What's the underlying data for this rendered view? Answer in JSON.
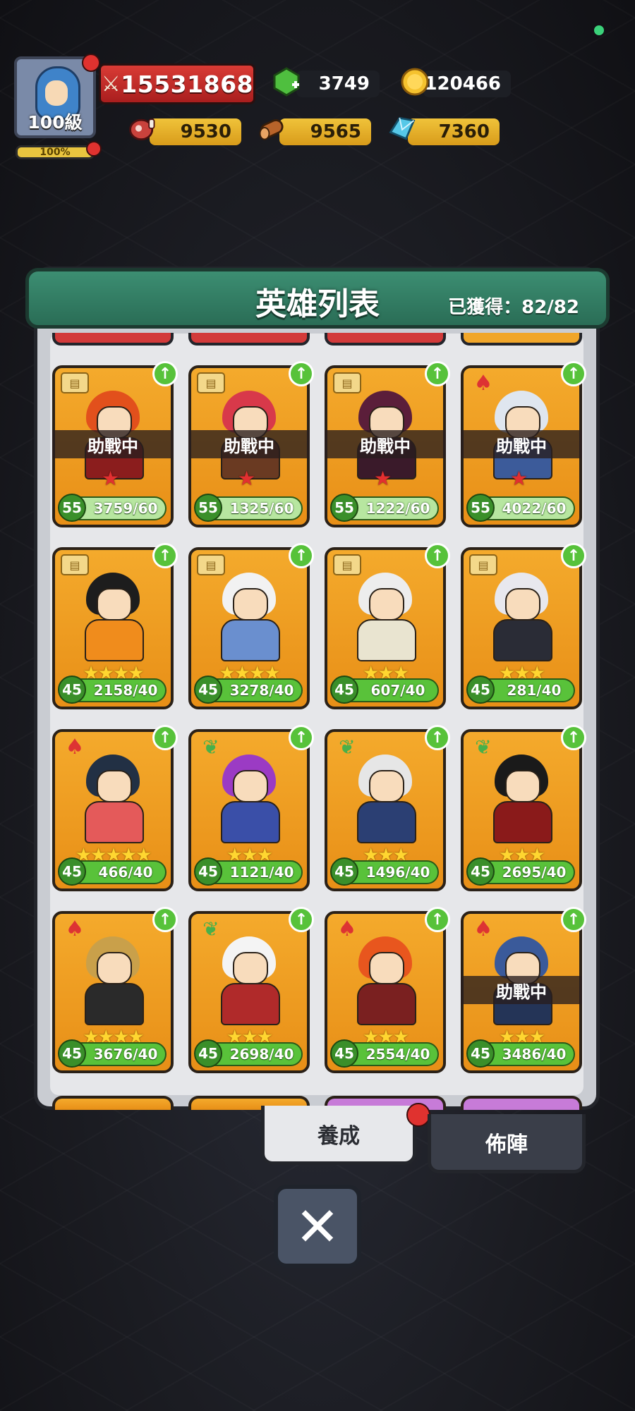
{
  "hud": {
    "player_level": "100級",
    "exp_percent": "100%",
    "power": "15531868",
    "gems": "3749",
    "gold": "120466",
    "meat": "9530",
    "wood": "9565",
    "crystal": "7360"
  },
  "panel": {
    "title": "英雄列表",
    "obtained": "已獲得：82/82"
  },
  "tabs": {
    "train": "養成",
    "formation": "佈陣"
  },
  "assist_label": "助戰中",
  "heroes": [
    {
      "lv": "55",
      "count": "3759/60",
      "cls": "book",
      "stars": "",
      "red": true,
      "assist": true,
      "hair": "#e2501c",
      "body": "#8b1d1d",
      "light": true
    },
    {
      "lv": "55",
      "count": "1325/60",
      "cls": "book",
      "stars": "",
      "red": true,
      "assist": true,
      "hair": "#d8394a",
      "body": "#6a3a22",
      "light": true
    },
    {
      "lv": "55",
      "count": "1222/60",
      "cls": "book",
      "stars": "",
      "red": true,
      "assist": true,
      "hair": "#5b1e3a",
      "body": "#3a1a2a",
      "light": true
    },
    {
      "lv": "55",
      "count": "4022/60",
      "cls": "axe",
      "stars": "",
      "red": true,
      "assist": true,
      "hair": "#dfe6ef",
      "body": "#3c5b9a",
      "light": true
    },
    {
      "lv": "45",
      "count": "2158/40",
      "cls": "book",
      "stars": "★★★★",
      "red": false,
      "assist": false,
      "hair": "#1d1d1d",
      "body": "#f08c1c",
      "light": false
    },
    {
      "lv": "45",
      "count": "3278/40",
      "cls": "book",
      "stars": "★★★★",
      "red": false,
      "assist": false,
      "hair": "#f2f2f2",
      "body": "#6a8fcf",
      "light": false
    },
    {
      "lv": "45",
      "count": "607/40",
      "cls": "book",
      "stars": "★★★",
      "red": false,
      "assist": false,
      "hair": "#ededed",
      "body": "#e9e4d0",
      "light": false
    },
    {
      "lv": "45",
      "count": "281/40",
      "cls": "book",
      "stars": "★★★",
      "red": false,
      "assist": false,
      "hair": "#e8e8ee",
      "body": "#2a2c36",
      "light": false
    },
    {
      "lv": "45",
      "count": "466/40",
      "cls": "axe",
      "stars": "★★★★★",
      "red": false,
      "assist": false,
      "hair": "#223044",
      "body": "#e45a5a",
      "light": false
    },
    {
      "lv": "45",
      "count": "1121/40",
      "cls": "leaf",
      "stars": "★★★",
      "red": false,
      "assist": false,
      "hair": "#9b3bc4",
      "body": "#3a4fa8",
      "light": false
    },
    {
      "lv": "45",
      "count": "1496/40",
      "cls": "leaf",
      "stars": "★★★",
      "red": false,
      "assist": false,
      "hair": "#e6e6e6",
      "body": "#2b3f73",
      "light": false
    },
    {
      "lv": "45",
      "count": "2695/40",
      "cls": "leaf",
      "stars": "★★★",
      "red": false,
      "assist": false,
      "hair": "#1a1a1a",
      "body": "#8a1a1a",
      "light": false
    },
    {
      "lv": "45",
      "count": "3676/40",
      "cls": "axe",
      "stars": "★★★★",
      "red": false,
      "assist": false,
      "hair": "#c9a04a",
      "body": "#2a2a2a",
      "light": false
    },
    {
      "lv": "45",
      "count": "2698/40",
      "cls": "leaf",
      "stars": "★★★",
      "red": false,
      "assist": false,
      "hair": "#f4f4f4",
      "body": "#b02a2a",
      "light": false
    },
    {
      "lv": "45",
      "count": "2554/40",
      "cls": "axe",
      "stars": "★★★",
      "red": false,
      "assist": false,
      "hair": "#e8561e",
      "body": "#7a2020",
      "light": false
    },
    {
      "lv": "45",
      "count": "3486/40",
      "cls": "axe",
      "stars": "★★★",
      "red": false,
      "assist": true,
      "hair": "#3a5a9a",
      "body": "#243457",
      "light": false
    }
  ]
}
